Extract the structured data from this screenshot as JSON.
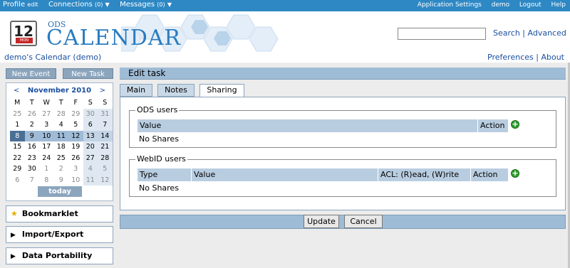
{
  "topbar": {
    "profile": "Profile",
    "edit": "edit",
    "connections": "Connections",
    "connections_count": "(0)",
    "messages": "Messages",
    "messages_count": "(0)",
    "right": [
      "Application Settings",
      "demo",
      "Logout",
      "Help"
    ]
  },
  "header": {
    "icon_day": "12",
    "icon_month": "MON",
    "ods": "ODS",
    "title": "CALENDAR",
    "search_value": "",
    "search_link": "Search",
    "advanced_link": "Advanced",
    "separator": "|"
  },
  "subline": {
    "calendar_title": "demo's Calendar (demo)",
    "preferences": "Preferences",
    "about": "About"
  },
  "sidebar": {
    "new_event": "New Event",
    "new_task": "New Task",
    "calendar": {
      "prev": "<",
      "next": ">",
      "month": "November 2010",
      "weekdays": [
        "M",
        "T",
        "W",
        "T",
        "F",
        "S",
        "S"
      ],
      "weeks": [
        [
          "25",
          "26",
          "27",
          "28",
          "29",
          "30",
          "31"
        ],
        [
          "1",
          "2",
          "3",
          "4",
          "5",
          "6",
          "7"
        ],
        [
          "8",
          "9",
          "10",
          "11",
          "12",
          "13",
          "14"
        ],
        [
          "15",
          "16",
          "17",
          "18",
          "19",
          "20",
          "21"
        ],
        [
          "22",
          "23",
          "24",
          "25",
          "26",
          "27",
          "28"
        ],
        [
          "29",
          "30",
          "1",
          "2",
          "3",
          "4",
          "5"
        ],
        [
          "6",
          "7",
          "8",
          "9",
          "10",
          "11",
          "12"
        ]
      ],
      "today": "today"
    },
    "bookmarklet": "Bookmarklet",
    "import_export": "Import/Export",
    "data_portability": "Data Portability"
  },
  "main": {
    "title": "Edit task",
    "tabs": [
      "Main",
      "Notes",
      "Sharing"
    ],
    "ods_users": {
      "legend": "ODS users",
      "columns": [
        "Value",
        "Action"
      ],
      "empty": "No Shares"
    },
    "webid_users": {
      "legend": "WebID users",
      "columns": [
        "Type",
        "Value",
        "ACL: (R)ead, (W)rite",
        "Action"
      ],
      "empty": "No Shares"
    },
    "update": "Update",
    "cancel": "Cancel"
  },
  "colors": {
    "topbar": "#2e88c4",
    "accent": "#9fbcd6",
    "link": "#1a4fa0"
  }
}
